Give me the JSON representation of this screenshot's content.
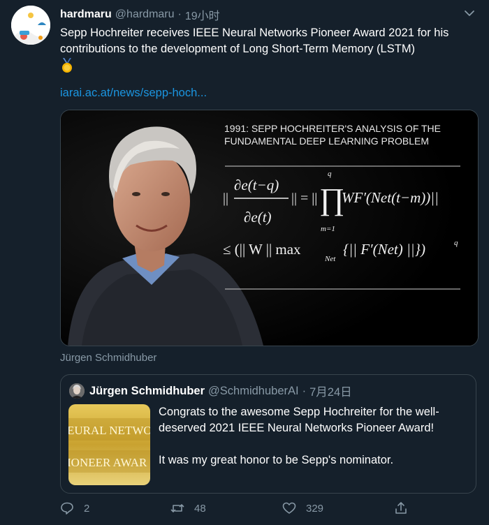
{
  "tweet": {
    "author_name": "hardmaru",
    "author_handle": "@hardmaru",
    "separator": "·",
    "time": "19小时",
    "text": "Sepp Hochreiter receives IEEE Neural Networks Pioneer Award 2021 for his contributions to the development of Long Short-Term Memory (LSTM)",
    "link": "iarai.ac.at/news/sepp-hoch...",
    "media_caption": "Jürgen Schmidhuber"
  },
  "media": {
    "heading_line1": "1991: SEPP HOCHREITER'S ANALYSIS OF THE",
    "heading_line2": "FUNDAMENTAL DEEP LEARNING PROBLEM",
    "eq_partial_num": "∂e(t−q)",
    "eq_partial_den": "∂e(t)",
    "eq_norm_left": "||",
    "eq_mid": "|| = ||",
    "eq_prod_sup": "q",
    "eq_prod_sub": "m=1",
    "eq_rhs": "WF′(Net(t−m))||",
    "eq_line2": "≤ (|| W || max",
    "eq_line2_sub": "Net",
    "eq_line2_rest": "{|| F′(Net) ||})",
    "eq_line2_sup": "q"
  },
  "quoted": {
    "author_name": "Jürgen Schmidhuber",
    "author_handle": "@SchmidhuberAI",
    "separator": "·",
    "time": "7月24日",
    "paragraph1": "Congrats to the awesome Sepp Hochreiter for the well-deserved 2021 IEEE Neural Networks Pioneer Award!",
    "paragraph2": "It was my great honor to be Sepp's nominator.",
    "thumb_line1": "EURAL NETWORK",
    "thumb_line2": "IONEER AWAR"
  },
  "actions": {
    "reply_count": "2",
    "retweet_count": "48",
    "like_count": "329"
  },
  "colors": {
    "background": "#15202b",
    "secondary_text": "#8899a6",
    "link": "#1b95e0",
    "border": "#38444d"
  }
}
